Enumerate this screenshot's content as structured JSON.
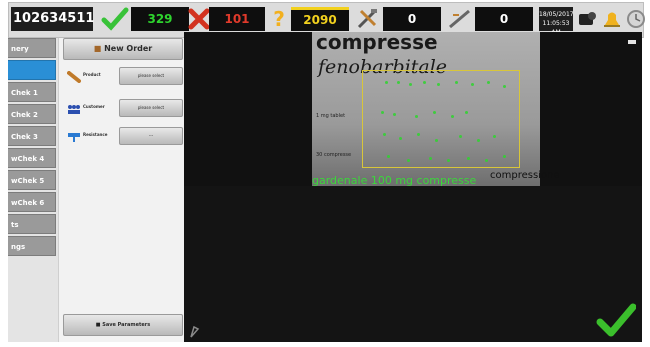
{
  "toolbar": {
    "serial": "102634511",
    "good_count": "329",
    "reject_count": "101",
    "unknown_count": "2090",
    "counter_a": "0",
    "counter_b": "0",
    "datetime_line1": "18/05/2017",
    "datetime_line2": "11:05:53 AM"
  },
  "tabs": [
    {
      "label": "nery",
      "active": false
    },
    {
      "label": "",
      "active": true
    },
    {
      "label": "Chek 1",
      "active": false
    },
    {
      "label": "Chek 2",
      "active": false
    },
    {
      "label": "Chek 3",
      "active": false
    },
    {
      "label": "wChek 4",
      "active": false
    },
    {
      "label": "wChek 5",
      "active": false
    },
    {
      "label": "wChek 6",
      "active": false
    },
    {
      "label": "ts",
      "active": false
    },
    {
      "label": "ngs",
      "active": false
    }
  ],
  "panel": {
    "new_order": "New Order",
    "rows": [
      {
        "label": "Product",
        "field": "please select"
      },
      {
        "label": "Customer",
        "field": "please select"
      },
      {
        "label": "Resistance",
        "field": "---"
      }
    ],
    "save_params": "Save Parameters"
  },
  "camera": {
    "line1": "compresse",
    "line2": "fenobarbitale",
    "line3": "1 mg tablet",
    "line4": "30 compresse",
    "line5": "compressione",
    "recognized": "gardenale 100 mg compresse"
  },
  "colors": {
    "accent_tab": "#2a8fd6",
    "good": "#2ed42e",
    "reject": "#e13a2b",
    "unknown": "#f2d11e"
  }
}
